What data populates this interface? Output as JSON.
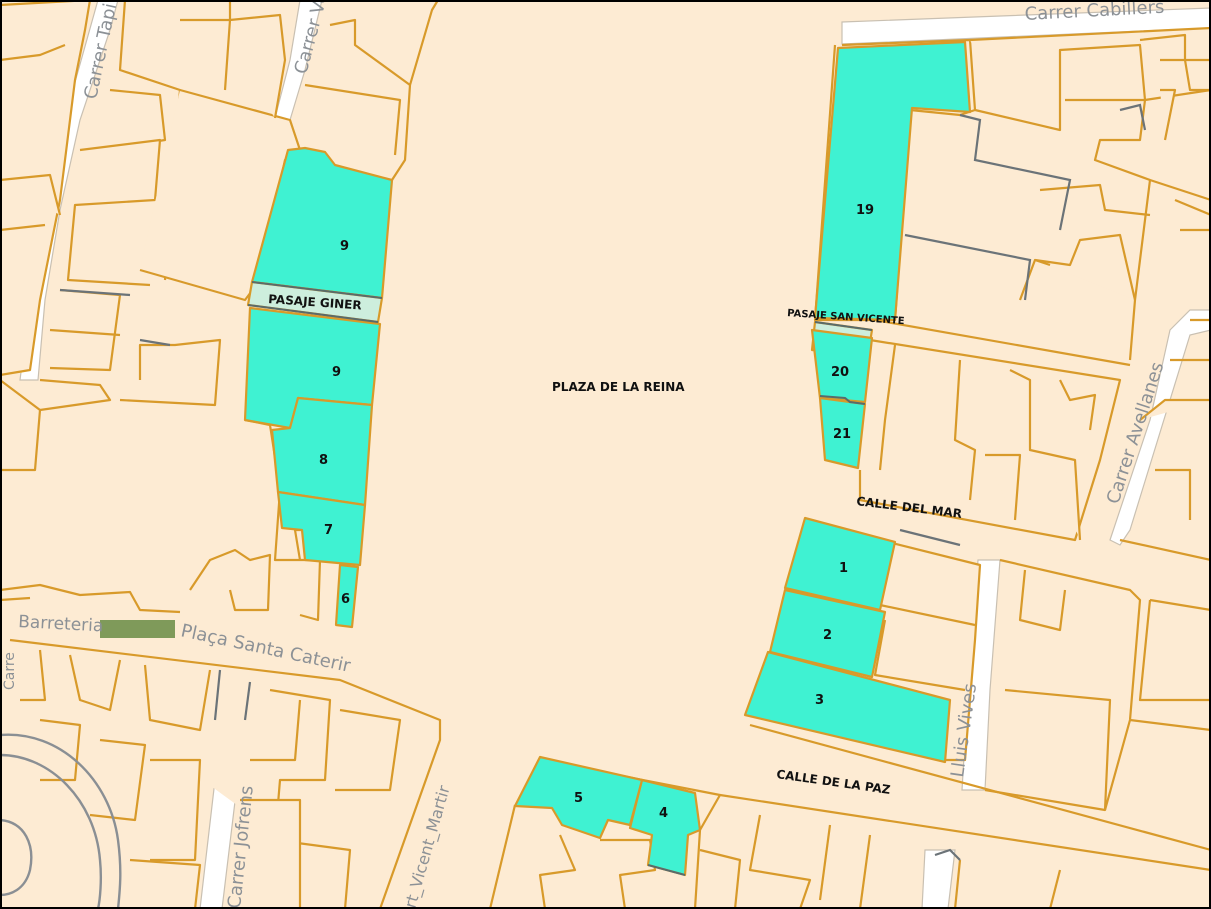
{
  "map": {
    "square_label": "PLAZA DE LA REINA",
    "street_labels": {
      "pasaje_giner": "PASAJE GINER",
      "pasaje_san_vicente": "PASAJE SAN VICENTE",
      "calle_del_mar": "CALLE DEL MAR",
      "calle_de_la_paz": "CALLE DE LA PAZ",
      "carrer_cabillers": "Carrer Cabillers",
      "carrer_tapineria": "Carrer Tapi",
      "carrer_ve": "Carrer Ve",
      "carrer_avellanes": "Carrer Avellanes",
      "barreteria": "Barreteria",
      "placa_santa_caterina": "Plaça Santa Caterir",
      "carrer_jofrens": "Carrer Jofrens",
      "vicent_martir": "rt_Vicent_Martir",
      "lluis_vives": "Lluis Vives",
      "carrer_cro": "Carre"
    },
    "plots": [
      {
        "id": "plot-9-north",
        "label": "9"
      },
      {
        "id": "plot-9-south",
        "label": "9"
      },
      {
        "id": "plot-8",
        "label": "8"
      },
      {
        "id": "plot-7",
        "label": "7"
      },
      {
        "id": "plot-6",
        "label": "6"
      },
      {
        "id": "plot-19",
        "label": "19"
      },
      {
        "id": "plot-20",
        "label": "20"
      },
      {
        "id": "plot-21",
        "label": "21"
      },
      {
        "id": "plot-1",
        "label": "1"
      },
      {
        "id": "plot-2",
        "label": "2"
      },
      {
        "id": "plot-3",
        "label": "3"
      },
      {
        "id": "plot-4",
        "label": "4"
      },
      {
        "id": "plot-5",
        "label": "5"
      }
    ],
    "colors": {
      "background": "#fdebd3",
      "parcel_outline": "#d89a2a",
      "highlighted_plot": "#3ff2d2",
      "street_label": "#8c9196",
      "plot_label": "#111111"
    }
  }
}
